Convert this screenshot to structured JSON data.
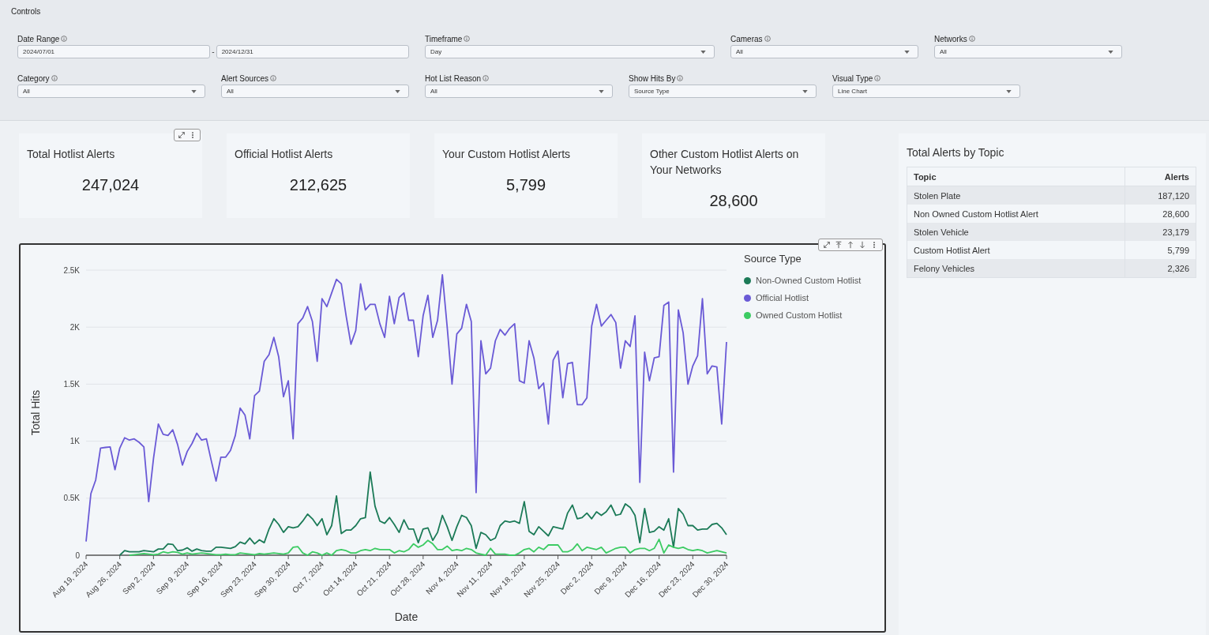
{
  "controls": {
    "title": "Controls",
    "filters": [
      {
        "label": "Date Range",
        "kind": "date_range",
        "values": [
          "2024/07/01",
          "2024/12/31"
        ],
        "separator": "-"
      },
      {
        "label": "Timeframe",
        "kind": "dropdown",
        "value": "Day"
      },
      {
        "label": "Cameras",
        "kind": "dropdown",
        "value": "All"
      },
      {
        "label": "Networks",
        "kind": "dropdown",
        "value": "All"
      },
      {
        "label": "Category",
        "kind": "dropdown",
        "value": "All"
      },
      {
        "label": "Alert Sources",
        "kind": "dropdown",
        "value": "All"
      },
      {
        "label": "Hot List Reason",
        "kind": "dropdown",
        "value": "All"
      },
      {
        "label": "Show Hits By",
        "kind": "dropdown",
        "value": "Source Type"
      },
      {
        "label": "Visual Type",
        "kind": "dropdown",
        "value": "Line Chart"
      }
    ]
  },
  "kpis": [
    {
      "title": "Total Hotlist Alerts",
      "value": "247,024"
    },
    {
      "title": "Official Hotlist Alerts",
      "value": "212,625"
    },
    {
      "title": "Your Custom Hotlist Alerts",
      "value": "5,799"
    },
    {
      "title": "Other Custom Hotlist Alerts on Your Networks",
      "value": "28,600"
    }
  ],
  "chart": {
    "legend_title": "Source Type",
    "chart_data": {
      "type": "line",
      "xlabel": "Date",
      "ylabel": "Total Hits",
      "ylim": [
        0,
        2500
      ],
      "grid": true,
      "categories": [
        "Aug 19, 2024",
        null,
        null,
        null,
        null,
        null,
        null,
        "Aug 26, 2024",
        null,
        null,
        null,
        null,
        null,
        null,
        "Sep 2, 2024",
        null,
        null,
        null,
        null,
        null,
        null,
        "Sep 9, 2024",
        null,
        null,
        null,
        null,
        null,
        null,
        "Sep 16, 2024",
        null,
        null,
        null,
        null,
        null,
        null,
        "Sep 23, 2024",
        null,
        null,
        null,
        null,
        null,
        null,
        "Sep 30, 2024",
        null,
        null,
        null,
        null,
        null,
        null,
        "Oct 7, 2024",
        null,
        null,
        null,
        null,
        null,
        null,
        "Oct 14, 2024",
        null,
        null,
        null,
        null,
        null,
        null,
        "Oct 21, 2024",
        null,
        null,
        null,
        null,
        null,
        null,
        "Oct 28, 2024",
        null,
        null,
        null,
        null,
        null,
        null,
        "Nov 4, 2024",
        null,
        null,
        null,
        null,
        null,
        null,
        "Nov 11, 2024",
        null,
        null,
        null,
        null,
        null,
        null,
        "Nov 18, 2024",
        null,
        null,
        null,
        null,
        null,
        null,
        "Nov 25, 2024",
        null,
        null,
        null,
        null,
        null,
        null,
        "Dec 2, 2024",
        null,
        null,
        null,
        null,
        null,
        null,
        "Dec 9, 2024",
        null,
        null,
        null,
        null,
        null,
        null,
        "Dec 16, 2024",
        null,
        null,
        null,
        null,
        null,
        null,
        "Dec 23, 2024",
        null,
        null,
        null,
        null,
        null,
        null,
        "Dec 30, 2024"
      ],
      "yticks": [
        {
          "value": 0,
          "label": "0"
        },
        {
          "value": 500,
          "label": "0.5K"
        },
        {
          "value": 1000,
          "label": "1K"
        },
        {
          "value": 1500,
          "label": "1.5K"
        },
        {
          "value": 2000,
          "label": "2K"
        },
        {
          "value": 2500,
          "label": "2.5K"
        }
      ],
      "series": [
        {
          "name": "Non-Owned Custom Hotlist",
          "color": "#1b7a57",
          "values": [
            null,
            null,
            null,
            null,
            null,
            null,
            null,
            0,
            40,
            30,
            30,
            30,
            40,
            35,
            30,
            55,
            55,
            100,
            95,
            40,
            45,
            65,
            35,
            55,
            40,
            35,
            35,
            70,
            70,
            65,
            60,
            75,
            115,
            100,
            150,
            100,
            135,
            110,
            230,
            320,
            270,
            200,
            250,
            240,
            250,
            300,
            360,
            320,
            260,
            320,
            180,
            260,
            520,
            190,
            220,
            220,
            260,
            320,
            330,
            730,
            430,
            300,
            280,
            330,
            270,
            200,
            310,
            230,
            230,
            110,
            230,
            240,
            130,
            200,
            350,
            250,
            130,
            250,
            350,
            330,
            260,
            60,
            200,
            180,
            130,
            150,
            260,
            300,
            290,
            300,
            280,
            470,
            210,
            180,
            250,
            210,
            170,
            250,
            240,
            230,
            370,
            440,
            320,
            330,
            370,
            320,
            380,
            350,
            380,
            440,
            350,
            360,
            450,
            420,
            350,
            110,
            410,
            200,
            210,
            250,
            220,
            320,
            70,
            410,
            360,
            260,
            260,
            220,
            230,
            230,
            270,
            280,
            240,
            180
          ]
        },
        {
          "name": "Official Hotlist",
          "color": "#6a5ad6",
          "values": [
            120,
            540,
            660,
            940,
            945,
            950,
            750,
            940,
            1030,
            1010,
            1020,
            990,
            950,
            470,
            850,
            1150,
            1060,
            1050,
            1100,
            970,
            790,
            910,
            980,
            1070,
            1010,
            1020,
            830,
            650,
            860,
            860,
            920,
            1050,
            1290,
            1230,
            1020,
            1400,
            1440,
            1700,
            1760,
            1910,
            1740,
            1390,
            1530,
            1020,
            2030,
            2080,
            2180,
            2050,
            1700,
            2250,
            2180,
            2300,
            2420,
            2380,
            2100,
            1850,
            1970,
            2380,
            2150,
            2200,
            2200,
            2030,
            1910,
            2270,
            2030,
            2260,
            2300,
            2060,
            2060,
            1740,
            2100,
            2280,
            1910,
            2060,
            2460,
            2000,
            1500,
            1940,
            1990,
            2200,
            2050,
            550,
            1880,
            1590,
            1640,
            1880,
            1980,
            1930,
            1990,
            2030,
            1530,
            1510,
            1880,
            1730,
            1460,
            1510,
            1150,
            1710,
            1790,
            1380,
            1680,
            1690,
            1320,
            1320,
            1380,
            2010,
            2200,
            2010,
            2060,
            2110,
            2040,
            1640,
            1880,
            1830,
            2100,
            640,
            1780,
            1530,
            1730,
            1740,
            2190,
            2220,
            730,
            2150,
            1950,
            1500,
            1660,
            1750,
            2250,
            1590,
            1660,
            1650,
            1150,
            1870
          ]
        },
        {
          "name": "Owned Custom Hotlist",
          "color": "#3ccb63",
          "values": [
            null,
            null,
            null,
            null,
            null,
            null,
            null,
            null,
            null,
            0,
            5,
            10,
            15,
            10,
            5,
            10,
            30,
            20,
            30,
            25,
            10,
            20,
            10,
            15,
            20,
            15,
            10,
            5,
            5,
            10,
            5,
            5,
            20,
            15,
            10,
            5,
            15,
            10,
            15,
            20,
            15,
            10,
            20,
            70,
            75,
            20,
            0,
            30,
            20,
            0,
            20,
            0,
            40,
            50,
            40,
            20,
            20,
            40,
            50,
            40,
            60,
            50,
            50,
            50,
            20,
            40,
            30,
            50,
            100,
            70,
            90,
            130,
            100,
            50,
            50,
            80,
            40,
            50,
            40,
            60,
            50,
            20,
            10,
            0,
            60,
            10,
            10,
            10,
            0,
            0,
            20,
            50,
            60,
            30,
            70,
            50,
            90,
            90,
            90,
            30,
            30,
            50,
            100,
            40,
            70,
            60,
            50,
            70,
            20,
            40,
            60,
            70,
            70,
            20,
            50,
            60,
            60,
            40,
            60,
            140,
            20,
            90,
            70,
            60,
            70,
            50,
            40,
            50,
            40,
            20,
            30,
            40,
            30,
            20
          ]
        }
      ]
    }
  },
  "topic_table": {
    "title": "Total Alerts by Topic",
    "columns": [
      "Topic",
      "Alerts"
    ],
    "rows": [
      [
        "Stolen Plate",
        "187,120"
      ],
      [
        "Non Owned Custom Hotlist Alert",
        "28,600"
      ],
      [
        "Stolen Vehicle",
        "23,179"
      ],
      [
        "Custom Hotlist Alert",
        "5,799"
      ],
      [
        "Felony Vehicles",
        "2,326"
      ]
    ]
  }
}
